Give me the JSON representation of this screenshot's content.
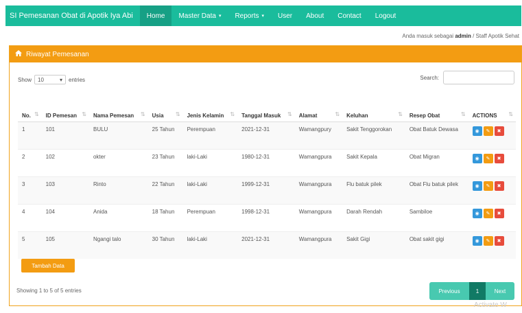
{
  "navbar": {
    "brand": "SI Pemesanan Obat di Apotik Iya Abi",
    "items": [
      {
        "label": "Home",
        "caret": ""
      },
      {
        "label": "Master Data",
        "caret": "▾"
      },
      {
        "label": "Reports",
        "caret": "▾"
      },
      {
        "label": "User",
        "caret": ""
      },
      {
        "label": "About",
        "caret": ""
      },
      {
        "label": "Contact",
        "caret": ""
      },
      {
        "label": "Logout",
        "caret": ""
      }
    ]
  },
  "userline": {
    "prefix": "Anda masuk sebagai",
    "user": "admin",
    "suffix": " / Staff Apotik Sehat"
  },
  "panel": {
    "title": "Riwayat Pemesanan"
  },
  "controls": {
    "show_label": "Show",
    "length_value": "10",
    "entries_label": "entries",
    "search_label": "Search:",
    "search_value": ""
  },
  "table": {
    "headers": [
      "No.",
      "ID Pemesan",
      "Nama Pemesan",
      "Usia",
      "Jenis Kelamin",
      "Tanggal Masuk",
      "Alamat",
      "Keluhan",
      "Resep Obat",
      "ACTIONS"
    ],
    "rows": [
      [
        "1",
        "101",
        "BULU",
        "25 Tahun",
        "Perempuan",
        "2021-12-31",
        "Wamangpury",
        "Sakit Tenggorokan",
        "Obat Batuk Dewasa"
      ],
      [
        "2",
        "102",
        "okter",
        "23 Tahun",
        "laki-Laki",
        "1980-12-31",
        "Wamangpura",
        "Sakit Kepala",
        "Obat Migran"
      ],
      [
        "3",
        "103",
        "Rinto",
        "22 Tahun",
        "laki-Laki",
        "1999-12-31",
        "Wamangpura",
        "Flu batuk pilek",
        "Obat Flu batuk pilek"
      ],
      [
        "4",
        "104",
        "Anida",
        "18 Tahun",
        "Perempuan",
        "1998-12-31",
        "Wamangpura",
        "Darah Rendah",
        "Sambiloe"
      ],
      [
        "5",
        "105",
        "Ngangi talo",
        "30 Tahun",
        "laki-Laki",
        "2021-12-31",
        "Wamangpura",
        "Sakit Gigi",
        "Obat sakit gigi"
      ]
    ],
    "action_icons": [
      "eye-icon",
      "pencil-icon",
      "trash-icon"
    ]
  },
  "add_button": "Tambah Data",
  "info": "Showing 1 to 5 of 5 entries",
  "pagination": {
    "prev": "Previous",
    "current": "1",
    "next": "Next"
  },
  "watermark": "Activate W",
  "colors": {
    "navbar": "#1abc9c",
    "panel": "#f39c12",
    "view": "#3498db",
    "edit": "#f39c12",
    "delete": "#e74c3c"
  }
}
